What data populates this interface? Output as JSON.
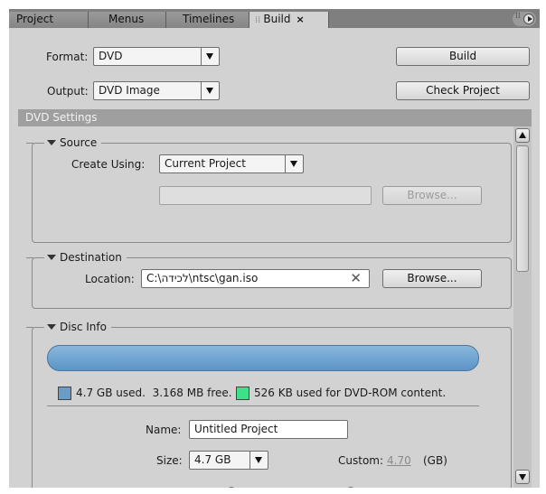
{
  "tabs": [
    {
      "label": "Project"
    },
    {
      "label": "Menus"
    },
    {
      "label": "Timelines"
    },
    {
      "label": "Build"
    }
  ],
  "form": {
    "format_label": "Format:",
    "format_value": "DVD",
    "output_label": "Output:",
    "output_value": "DVD Image",
    "build_button": "Build",
    "check_button": "Check Project"
  },
  "settings": {
    "header": "DVD Settings",
    "source": {
      "title": "Source",
      "create_using_label": "Create Using:",
      "create_using_value": "Current Project",
      "path_value": "",
      "browse_label": "Browse..."
    },
    "destination": {
      "title": "Destination",
      "location_label": "Location:",
      "location_value": "C:\\לכידה\\ntsc\\gan.iso",
      "browse_label": "Browse..."
    },
    "disc_info": {
      "title": "Disc Info",
      "used_percent": 100,
      "used_text": "4.7 GB used.",
      "free_text": "3.168 MB free.",
      "rom_text": "526 KB used for DVD-ROM content.",
      "name_label": "Name:",
      "name_value": "Untitled Project",
      "size_label": "Size:",
      "size_value": "4.7 GB",
      "custom_label": "Custom:",
      "custom_value": "4.70",
      "custom_unit": "(GB)"
    }
  },
  "colors": {
    "used_swatch": "#6a9cc8",
    "rom_swatch": "#3fe08a",
    "capacity_bar": "#6a9cc8"
  },
  "icons": {
    "close_tab": "×",
    "clear_field": "✕"
  }
}
